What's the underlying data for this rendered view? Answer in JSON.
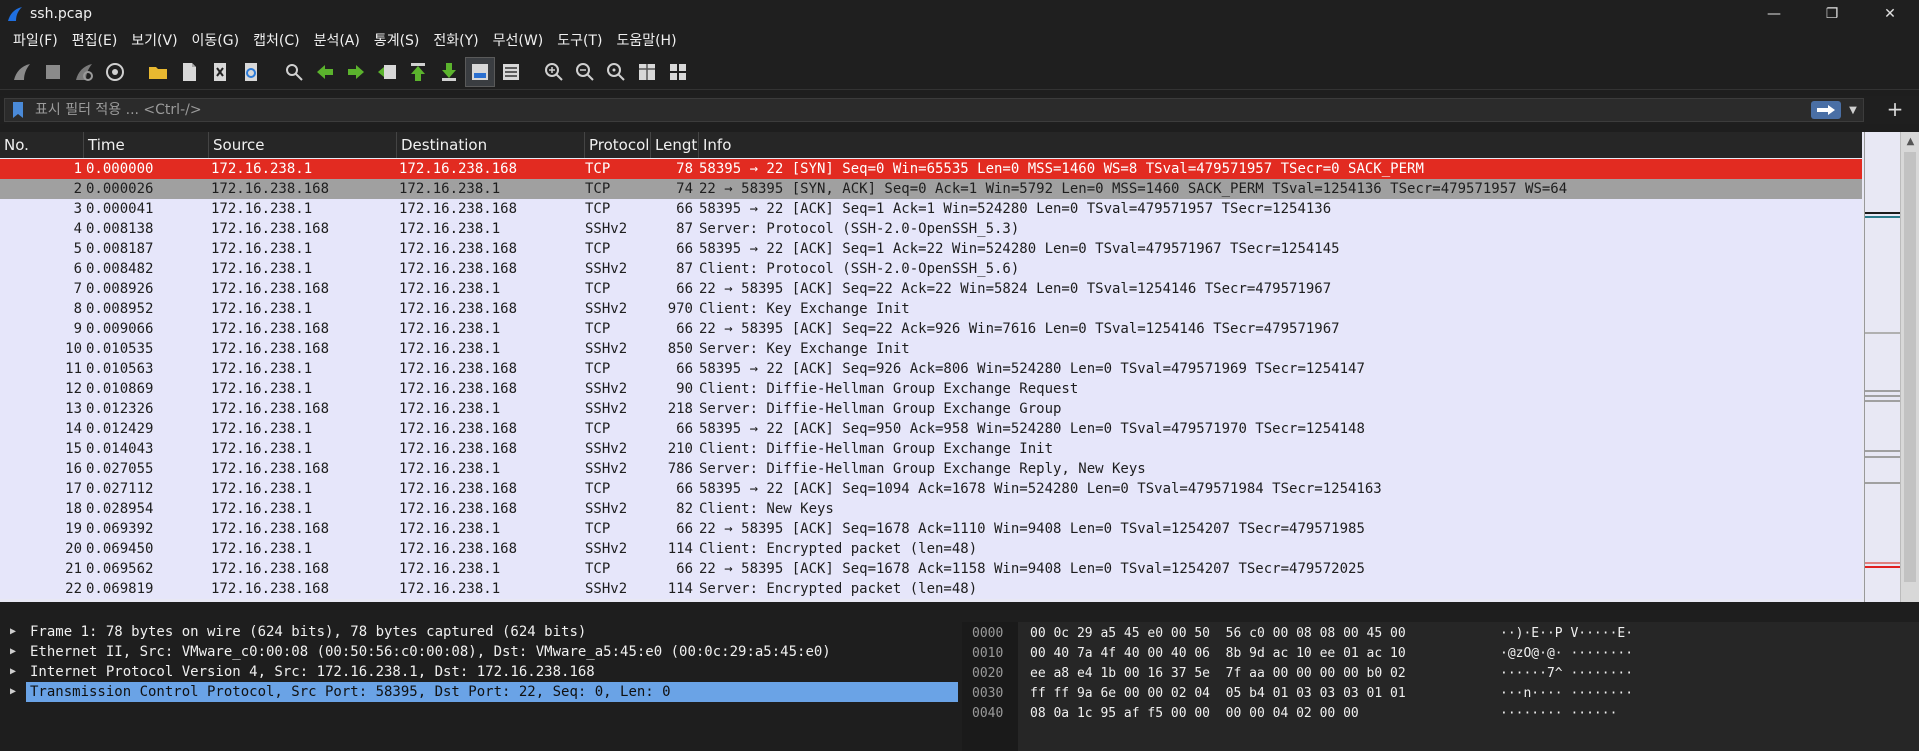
{
  "window": {
    "title": "ssh.pcap",
    "minimize": "—",
    "restore": "❐",
    "close": "✕"
  },
  "menu": [
    "파일(F)",
    "편집(E)",
    "보기(V)",
    "이동(G)",
    "캡처(C)",
    "분석(A)",
    "통계(S)",
    "전화(Y)",
    "무선(W)",
    "도구(T)",
    "도움말(H)"
  ],
  "filter": {
    "placeholder": "표시 필터 적용 ... <Ctrl-/>",
    "add": "+"
  },
  "columns": [
    "No.",
    "Time",
    "Source",
    "Destination",
    "Protocol",
    "Length",
    "Info"
  ],
  "packets": [
    {
      "no": "1",
      "time": "0.000000",
      "src": "172.16.238.1",
      "dst": "172.16.238.168",
      "proto": "TCP",
      "len": "78",
      "info": "58395 → 22 [SYN] Seq=0 Win=65535 Len=0 MSS=1460 WS=8 TSval=479571957 TSecr=0 SACK_PERM"
    },
    {
      "no": "2",
      "time": "0.000026",
      "src": "172.16.238.168",
      "dst": "172.16.238.1",
      "proto": "TCP",
      "len": "74",
      "info": "22 → 58395 [SYN, ACK] Seq=0 Ack=1 Win=5792 Len=0 MSS=1460 SACK_PERM TSval=1254136 TSecr=479571957 WS=64"
    },
    {
      "no": "3",
      "time": "0.000041",
      "src": "172.16.238.1",
      "dst": "172.16.238.168",
      "proto": "TCP",
      "len": "66",
      "info": "58395 → 22 [ACK] Seq=1 Ack=1 Win=524280 Len=0 TSval=479571957 TSecr=1254136"
    },
    {
      "no": "4",
      "time": "0.008138",
      "src": "172.16.238.168",
      "dst": "172.16.238.1",
      "proto": "SSHv2",
      "len": "87",
      "info": "Server: Protocol (SSH-2.0-OpenSSH_5.3)"
    },
    {
      "no": "5",
      "time": "0.008187",
      "src": "172.16.238.1",
      "dst": "172.16.238.168",
      "proto": "TCP",
      "len": "66",
      "info": "58395 → 22 [ACK] Seq=1 Ack=22 Win=524280 Len=0 TSval=479571967 TSecr=1254145"
    },
    {
      "no": "6",
      "time": "0.008482",
      "src": "172.16.238.1",
      "dst": "172.16.238.168",
      "proto": "SSHv2",
      "len": "87",
      "info": "Client: Protocol (SSH-2.0-OpenSSH_5.6)"
    },
    {
      "no": "7",
      "time": "0.008926",
      "src": "172.16.238.168",
      "dst": "172.16.238.1",
      "proto": "TCP",
      "len": "66",
      "info": "22 → 58395 [ACK] Seq=22 Ack=22 Win=5824 Len=0 TSval=1254146 TSecr=479571967"
    },
    {
      "no": "8",
      "time": "0.008952",
      "src": "172.16.238.1",
      "dst": "172.16.238.168",
      "proto": "SSHv2",
      "len": "970",
      "info": "Client: Key Exchange Init"
    },
    {
      "no": "9",
      "time": "0.009066",
      "src": "172.16.238.168",
      "dst": "172.16.238.1",
      "proto": "TCP",
      "len": "66",
      "info": "22 → 58395 [ACK] Seq=22 Ack=926 Win=7616 Len=0 TSval=1254146 TSecr=479571967"
    },
    {
      "no": "10",
      "time": "0.010535",
      "src": "172.16.238.168",
      "dst": "172.16.238.1",
      "proto": "SSHv2",
      "len": "850",
      "info": "Server: Key Exchange Init"
    },
    {
      "no": "11",
      "time": "0.010563",
      "src": "172.16.238.1",
      "dst": "172.16.238.168",
      "proto": "TCP",
      "len": "66",
      "info": "58395 → 22 [ACK] Seq=926 Ack=806 Win=524280 Len=0 TSval=479571969 TSecr=1254147"
    },
    {
      "no": "12",
      "time": "0.010869",
      "src": "172.16.238.1",
      "dst": "172.16.238.168",
      "proto": "SSHv2",
      "len": "90",
      "info": "Client: Diffie-Hellman Group Exchange Request"
    },
    {
      "no": "13",
      "time": "0.012326",
      "src": "172.16.238.168",
      "dst": "172.16.238.1",
      "proto": "SSHv2",
      "len": "218",
      "info": "Server: Diffie-Hellman Group Exchange Group"
    },
    {
      "no": "14",
      "time": "0.012429",
      "src": "172.16.238.1",
      "dst": "172.16.238.168",
      "proto": "TCP",
      "len": "66",
      "info": "58395 → 22 [ACK] Seq=950 Ack=958 Win=524280 Len=0 TSval=479571970 TSecr=1254148"
    },
    {
      "no": "15",
      "time": "0.014043",
      "src": "172.16.238.1",
      "dst": "172.16.238.168",
      "proto": "SSHv2",
      "len": "210",
      "info": "Client: Diffie-Hellman Group Exchange Init"
    },
    {
      "no": "16",
      "time": "0.027055",
      "src": "172.16.238.168",
      "dst": "172.16.238.1",
      "proto": "SSHv2",
      "len": "786",
      "info": "Server: Diffie-Hellman Group Exchange Reply, New Keys"
    },
    {
      "no": "17",
      "time": "0.027112",
      "src": "172.16.238.1",
      "dst": "172.16.238.168",
      "proto": "TCP",
      "len": "66",
      "info": "58395 → 22 [ACK] Seq=1094 Ack=1678 Win=524280 Len=0 TSval=479571984 TSecr=1254163"
    },
    {
      "no": "18",
      "time": "0.028954",
      "src": "172.16.238.1",
      "dst": "172.16.238.168",
      "proto": "SSHv2",
      "len": "82",
      "info": "Client: New Keys"
    },
    {
      "no": "19",
      "time": "0.069392",
      "src": "172.16.238.168",
      "dst": "172.16.238.1",
      "proto": "TCP",
      "len": "66",
      "info": "22 → 58395 [ACK] Seq=1678 Ack=1110 Win=9408 Len=0 TSval=1254207 TSecr=479571985"
    },
    {
      "no": "20",
      "time": "0.069450",
      "src": "172.16.238.1",
      "dst": "172.16.238.168",
      "proto": "SSHv2",
      "len": "114",
      "info": "Client: Encrypted packet (len=48)"
    },
    {
      "no": "21",
      "time": "0.069562",
      "src": "172.16.238.168",
      "dst": "172.16.238.1",
      "proto": "TCP",
      "len": "66",
      "info": "22 → 58395 [ACK] Seq=1678 Ack=1158 Win=9408 Len=0 TSval=1254207 TSecr=479572025"
    },
    {
      "no": "22",
      "time": "0.069819",
      "src": "172.16.238.168",
      "dst": "172.16.238.1",
      "proto": "SSHv2",
      "len": "114",
      "info": "Server: Encrypted packet (len=48)"
    }
  ],
  "details": [
    "Frame 1: 78 bytes on wire (624 bits), 78 bytes captured (624 bits)",
    "Ethernet II, Src: VMware_c0:00:08 (00:50:56:c0:00:08), Dst: VMware_a5:45:e0 (00:0c:29:a5:45:e0)",
    "Internet Protocol Version 4, Src: 172.16.238.1, Dst: 172.16.238.168",
    "Transmission Control Protocol, Src Port: 58395, Dst Port: 22, Seq: 0, Len: 0"
  ],
  "bytes": {
    "offsets": [
      "0000",
      "0010",
      "0020",
      "0030",
      "0040"
    ],
    "hex": [
      "00 0c 29 a5 45 e0 00 50  56 c0 00 08 08 00 45 00",
      "00 40 7a 4f 40 00 40 06  8b 9d ac 10 ee 01 ac 10",
      "ee a8 e4 1b 00 16 37 5e  7f aa 00 00 00 00 b0 02",
      "ff ff 9a 6e 00 00 02 04  05 b4 01 03 03 03 01 01",
      "08 0a 1c 95 af f5 00 00  00 00 04 02 00 00"
    ],
    "ascii": [
      "··)·E··P V·····E·",
      "·@zO@·@· ········",
      "······7^ ········",
      "···n···· ········",
      "········ ······"
    ]
  },
  "colors": {
    "selected_row": "#e22b21",
    "related_row": "#a0a0a0",
    "row_bg": "#e6e6fa",
    "detail_selected": "#6aa3e6"
  }
}
